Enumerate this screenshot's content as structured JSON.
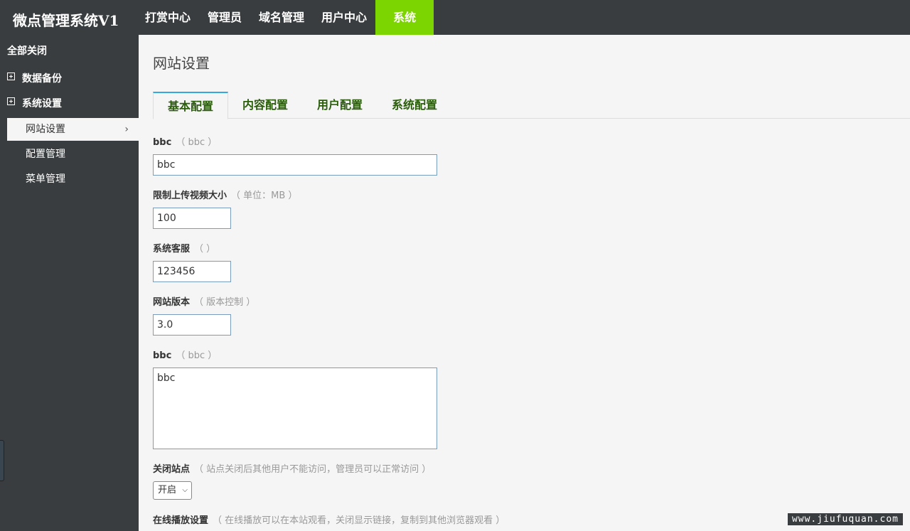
{
  "app": {
    "brand": "微点管理系统V1"
  },
  "topnav": {
    "items": [
      {
        "label": "打赏中心"
      },
      {
        "label": "管理员"
      },
      {
        "label": "域名管理"
      },
      {
        "label": "用户中心"
      },
      {
        "label": "系统"
      }
    ],
    "active_color": "#7cd400"
  },
  "sidebar": {
    "collapse_all": "全部关闭",
    "groups": [
      {
        "label": "数据备份",
        "icon": "plus-box-icon"
      },
      {
        "label": "系统设置",
        "icon": "plus-box-icon"
      }
    ],
    "items": [
      {
        "label": "网站设置",
        "active": true
      },
      {
        "label": "配置管理"
      },
      {
        "label": "菜单管理"
      }
    ],
    "chevron": "›"
  },
  "main": {
    "page_title": "网站设置",
    "tabs": [
      {
        "label": "基本配置",
        "active": true
      },
      {
        "label": "内容配置"
      },
      {
        "label": "用户配置"
      },
      {
        "label": "系统配置"
      }
    ],
    "fields": [
      {
        "label": "bbc",
        "hint": "（ bbc ）",
        "value": "bbc"
      },
      {
        "label": "限制上传视频大小",
        "hint": "（ 单位：MB ）",
        "value": "100"
      },
      {
        "label": "系统客服",
        "hint": "（  ）",
        "value": "123456"
      },
      {
        "label": "网站版本",
        "hint": "（ 版本控制 ）",
        "value": "3.0"
      },
      {
        "label": "bbc",
        "hint": "（ bbc ）",
        "value": "bbc"
      },
      {
        "label": "关闭站点",
        "hint": "（ 站点关闭后其他用户不能访问，管理员可以正常访问 ）",
        "value": "开启"
      },
      {
        "label": "在线播放设置",
        "hint": "（ 在线播放可以在本站观看，关闭显示链接，复制到其他浏览器观看 ）"
      }
    ]
  },
  "watermark": "www.jiufuquan.com"
}
